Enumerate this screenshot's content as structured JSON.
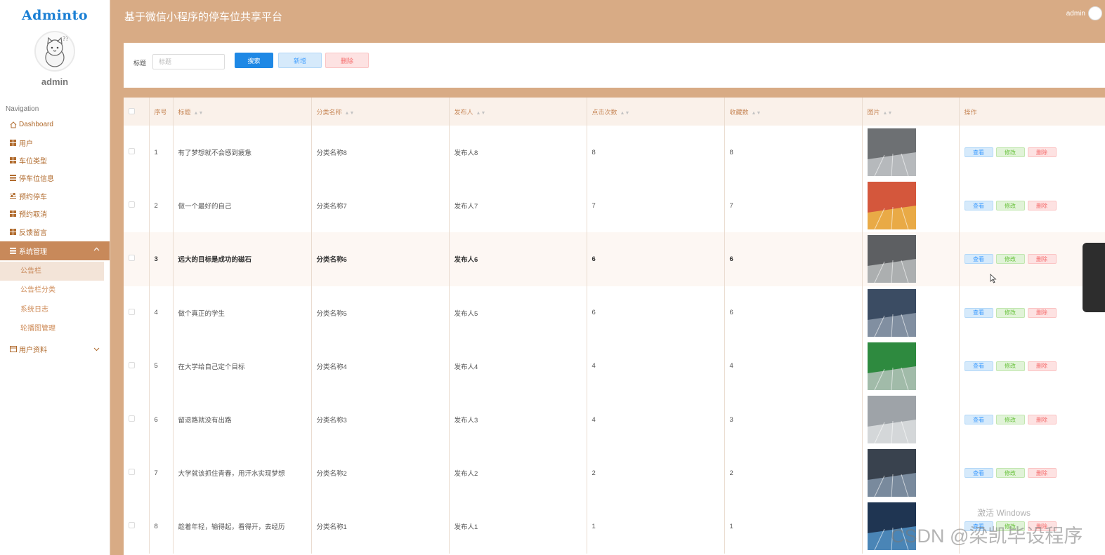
{
  "sidebar": {
    "logo": "Adminto",
    "username": "admin",
    "nav_title": "Navigation",
    "items": [
      {
        "label": "Dashboard",
        "icon": "home-icon"
      },
      {
        "label": "用户",
        "icon": "grid-icon"
      },
      {
        "label": "车位类型",
        "icon": "grid-icon"
      },
      {
        "label": "停车位信息",
        "icon": "list-icon"
      },
      {
        "label": "预约停车",
        "icon": "sliders-icon"
      },
      {
        "label": "预约取消",
        "icon": "grid-icon"
      },
      {
        "label": "反馈留言",
        "icon": "grid-icon"
      }
    ],
    "active_group": {
      "label": "系统管理",
      "icon": "list-icon"
    },
    "sub_items": [
      {
        "label": "公告栏"
      },
      {
        "label": "公告栏分类"
      },
      {
        "label": "系统日志"
      },
      {
        "label": "轮播图管理"
      }
    ],
    "collapsed_group": {
      "label": "用户资料",
      "icon": "card-icon"
    }
  },
  "header": {
    "title": "基于微信小程序的停车位共享平台",
    "user": "admin"
  },
  "search": {
    "label": "标题",
    "placeholder": "标题",
    "search_btn": "搜索",
    "add_btn": "新增",
    "delete_btn": "删除"
  },
  "table": {
    "columns": [
      "序号",
      "标题",
      "分类名称",
      "发布人",
      "点击次数",
      "收藏数",
      "图片",
      "操作"
    ],
    "rows": [
      {
        "index": "1",
        "title": "有了梦想就不会感到疲惫",
        "category": "分类名称8",
        "publisher": "发布人8",
        "clicks": "8",
        "favorites": "8"
      },
      {
        "index": "2",
        "title": "做一个最好的自己",
        "category": "分类名称7",
        "publisher": "发布人7",
        "clicks": "7",
        "favorites": "7"
      },
      {
        "index": "3",
        "title": "远大的目标是成功的磁石",
        "category": "分类名称6",
        "publisher": "发布人6",
        "clicks": "6",
        "favorites": "6"
      },
      {
        "index": "4",
        "title": "做个真正的学生",
        "category": "分类名称5",
        "publisher": "发布人5",
        "clicks": "6",
        "favorites": "6"
      },
      {
        "index": "5",
        "title": "在大学给自己定个目标",
        "category": "分类名称4",
        "publisher": "发布人4",
        "clicks": "4",
        "favorites": "4"
      },
      {
        "index": "6",
        "title": "留退路就没有出路",
        "category": "分类名称3",
        "publisher": "发布人3",
        "clicks": "4",
        "favorites": "3"
      },
      {
        "index": "7",
        "title": "大学就该抓住青春，用汗水实现梦想",
        "category": "分类名称2",
        "publisher": "发布人2",
        "clicks": "2",
        "favorites": "2"
      },
      {
        "index": "8",
        "title": "趁着年轻，输得起，看得开，去经历",
        "category": "分类名称1",
        "publisher": "发布人1",
        "clicks": "1",
        "favorites": "1"
      }
    ],
    "ops": {
      "view": "查看",
      "edit": "修改",
      "delete": "删除"
    }
  },
  "overlay": {
    "activate_windows": "激活 Windows",
    "csdn_watermark": "CSDN @梁凯毕设程序"
  },
  "colors": {
    "header_bg": "#d8ab85",
    "active_nav": "#c8895a",
    "primary": "#1e88e5"
  }
}
